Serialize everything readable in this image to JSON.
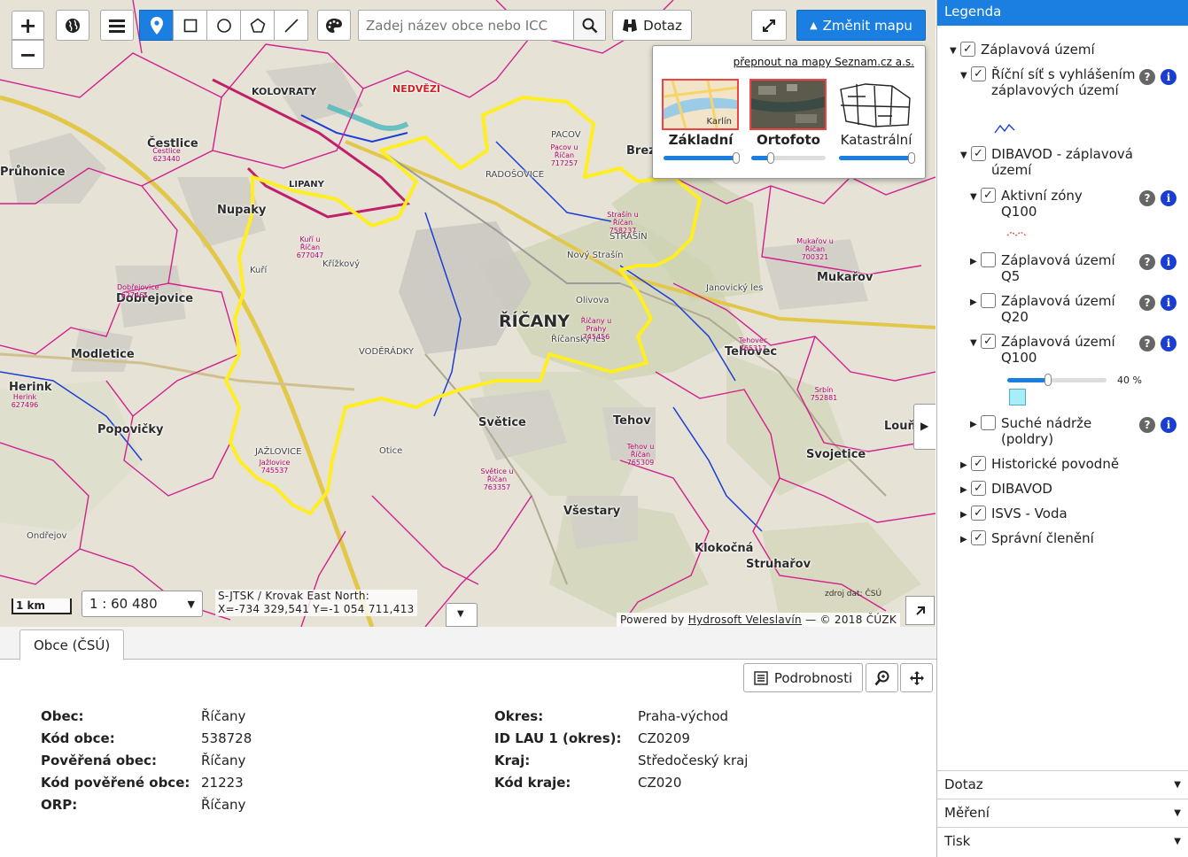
{
  "map": {
    "zoom_in": "+",
    "zoom_out": "−",
    "search_placeholder": "Zadej název obce nebo ICC",
    "dotaz_label": "Dotaz",
    "change_map_label": "Změnit mapu",
    "basemap": {
      "seznam_link": "přepnout na mapy Seznam.cz a.s.",
      "options": [
        {
          "label": "Základní",
          "selected": true,
          "thumb_text": "Karlín",
          "opacity": 1.0
        },
        {
          "label": "Ortofoto",
          "selected": true,
          "thumb_text": "",
          "opacity": 0.25
        },
        {
          "label": "Katastrální",
          "selected": false,
          "thumb_text": "",
          "opacity": 1.0
        }
      ]
    },
    "scale_bar": "1 km",
    "scale_value": "1 : 60 480",
    "coords_line1": "S-JTSK / Krovak East North:",
    "coords_line2": "X=-734 329,541 Y=-1 054 711,413",
    "powered_prefix": "Powered by ",
    "powered_link": "Hydrosoft Veleslavín",
    "powered_suffix": " — © 2018 ČÚZK",
    "data_source": "zdroj dat: ČSÚ",
    "places": [
      {
        "t": "Průhonice",
        "c": "place"
      },
      {
        "t": "Čestlice",
        "c": "place"
      },
      {
        "t": "Nupaky",
        "c": "place"
      },
      {
        "t": "Dobřejovice",
        "c": "place"
      },
      {
        "t": "Modletice",
        "c": "place"
      },
      {
        "t": "Herink",
        "c": "place"
      },
      {
        "t": "Popovičky",
        "c": "place"
      },
      {
        "t": "KOLOVRATY",
        "c": "place"
      },
      {
        "t": "NEDVĚZÍ",
        "c": "place"
      },
      {
        "t": "LIPANY",
        "c": "place"
      },
      {
        "t": "ŘÍČANY",
        "c": "place big"
      },
      {
        "t": "RADOŠOVICE",
        "c": "place sm"
      },
      {
        "t": "PACOV",
        "c": "place sm"
      },
      {
        "t": "STRAŠÍN",
        "c": "place sm"
      },
      {
        "t": "VODĚRÁDKY",
        "c": "place sm"
      },
      {
        "t": "JAŽLOVICE",
        "c": "place sm"
      },
      {
        "t": "Světice",
        "c": "place"
      },
      {
        "t": "Tehov",
        "c": "place"
      },
      {
        "t": "Tehovec",
        "c": "place"
      },
      {
        "t": "Mukařov",
        "c": "place"
      },
      {
        "t": "Všestary",
        "c": "place"
      },
      {
        "t": "Svojetice",
        "c": "place"
      },
      {
        "t": "Struhařov",
        "c": "place"
      },
      {
        "t": "Klokočná",
        "c": "place"
      },
      {
        "t": "Louň",
        "c": "place"
      },
      {
        "t": "Brez",
        "c": "place"
      },
      {
        "t": "Ondřejov",
        "c": "place sm"
      },
      {
        "t": "Otice",
        "c": "place sm"
      },
      {
        "t": "Kuří",
        "c": "place sm"
      },
      {
        "t": "Křížkový",
        "c": "place sm"
      },
      {
        "t": "Olivova",
        "c": "place sm"
      },
      {
        "t": "Nový Strašín",
        "c": "place sm"
      },
      {
        "t": "Janovický les",
        "c": "place sm"
      },
      {
        "t": "Říčanský les",
        "c": "place sm"
      },
      {
        "t": "Kuří u Říčan 677047",
        "c": "place mun"
      },
      {
        "t": "Říčany u Prahy 745456",
        "c": "place mun"
      },
      {
        "t": "Strašín u Říčan 758237",
        "c": "place mun"
      },
      {
        "t": "Tehov u Říčan 765309",
        "c": "place mun"
      },
      {
        "t": "Světice u Říčan 763357",
        "c": "place mun"
      },
      {
        "t": "Pacov u Říčan 717257",
        "c": "place mun"
      },
      {
        "t": "Mukařov u Říčan 700321",
        "c": "place mun"
      },
      {
        "t": "Tehovec 765317",
        "c": "place mun"
      },
      {
        "t": "Srbín 752881",
        "c": "place mun"
      },
      {
        "t": "Čestlice 623440",
        "c": "place mun"
      },
      {
        "t": "Dobřejovice 627461",
        "c": "place mun"
      },
      {
        "t": "Jažlovice 745537",
        "c": "place mun"
      },
      {
        "t": "Herink 627496",
        "c": "place mun"
      }
    ]
  },
  "legend": {
    "title": "Legenda",
    "items": [
      {
        "label": "Záplavová území",
        "checked": true,
        "expanded": true
      },
      {
        "label": "Říční síť s vyhlášením záplavových území",
        "checked": true,
        "expanded": true
      },
      {
        "label": "DIBAVOD - záplavová území",
        "checked": true,
        "expanded": true
      },
      {
        "label": "Aktivní zóny Q100",
        "checked": true,
        "expanded": true
      },
      {
        "label": "Záplavová území Q5",
        "checked": false,
        "expanded": false
      },
      {
        "label": "Záplavová území Q20",
        "checked": false,
        "expanded": false
      },
      {
        "label": "Záplavová území Q100",
        "checked": true,
        "expanded": true
      },
      {
        "label": "Suché nádrže (poldry)",
        "checked": false,
        "expanded": false
      },
      {
        "label": "Historické povodně",
        "checked": true,
        "expanded": false
      },
      {
        "label": "DIBAVOD",
        "checked": true,
        "expanded": false
      },
      {
        "label": "ISVS - Voda",
        "checked": true,
        "expanded": false
      },
      {
        "label": "Správní členění",
        "checked": true,
        "expanded": false
      }
    ],
    "q100_opacity": "40 %",
    "q100_opacity_value": 0.4,
    "help_glyph": "?",
    "info_glyph": "i",
    "accordion": [
      "Dotaz",
      "Měření",
      "Tisk"
    ]
  },
  "bottom": {
    "tab": "Obce (ČSÚ)",
    "details_label": "Podrobnosti",
    "left": [
      {
        "k": "Obec:",
        "v": "Říčany"
      },
      {
        "k": "Kód obce:",
        "v": "538728"
      },
      {
        "k": "Pověřená obec:",
        "v": "Říčany"
      },
      {
        "k": "Kód pověřené obce:",
        "v": "21223"
      },
      {
        "k": "ORP:",
        "v": "Říčany"
      }
    ],
    "right": [
      {
        "k": "Okres:",
        "v": "Praha-východ"
      },
      {
        "k": "ID LAU 1 (okres):",
        "v": "CZ0209"
      },
      {
        "k": "Kraj:",
        "v": "Středočeský kraj"
      },
      {
        "k": "Kód kraje:",
        "v": "CZ020"
      }
    ]
  },
  "colors": {
    "accent": "#1a7fe0",
    "boundary_selected": "#ffee22",
    "boundary_municipal": "#d0208f",
    "river": "#1b3fd6",
    "road": "#e4c840"
  }
}
